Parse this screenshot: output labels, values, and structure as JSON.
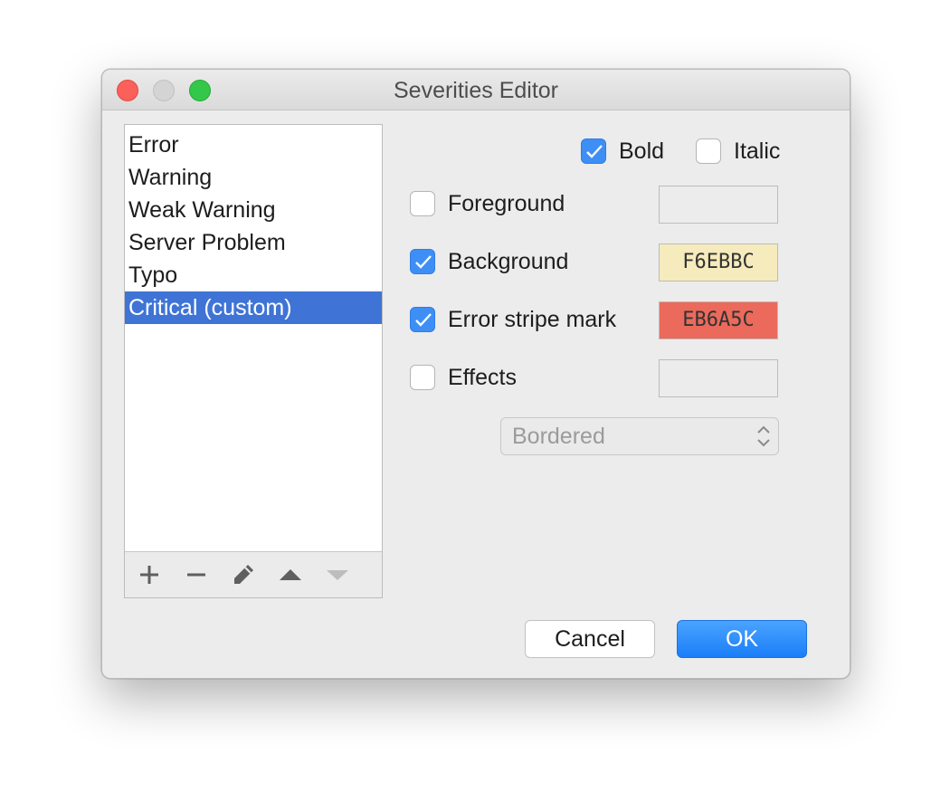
{
  "window": {
    "title": "Severities Editor"
  },
  "severity_list": {
    "items": [
      "Error",
      "Warning",
      "Weak Warning",
      "Server Problem",
      "Typo",
      "Critical (custom)"
    ],
    "selected": "Critical (custom)",
    "toolbar": [
      "add-icon",
      "remove-icon",
      "edit-icon",
      "move-up-icon",
      "move-down-icon"
    ]
  },
  "font_style": {
    "bold_label": "Bold",
    "bold_checked": true,
    "italic_label": "Italic",
    "italic_checked": false
  },
  "attributes": {
    "foreground_label": "Foreground",
    "foreground_checked": false,
    "foreground_value": "",
    "background_label": "Background",
    "background_checked": true,
    "background_value": "F6EBBC",
    "background_color": "#F6EBBC",
    "error_stripe_label": "Error stripe mark",
    "error_stripe_checked": true,
    "error_stripe_value": "EB6A5C",
    "error_stripe_color": "#EB6A5C",
    "effects_label": "Effects",
    "effects_checked": false,
    "effects_value": "",
    "effect_type": "Bordered"
  },
  "buttons": {
    "cancel_label": "Cancel",
    "ok_label": "OK"
  },
  "colors": {
    "selection": "#3F74D6",
    "checkbox_accent": "#3D8FF5",
    "ok_button": "#1A7EF8"
  }
}
